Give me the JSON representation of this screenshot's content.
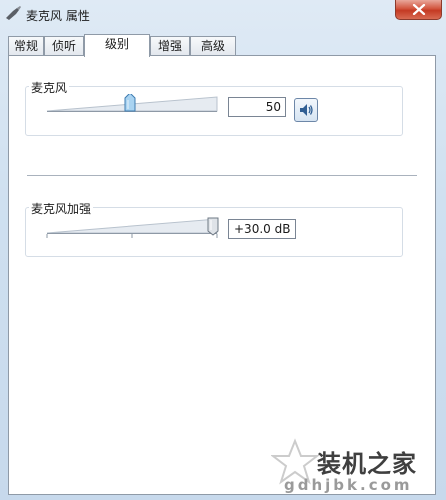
{
  "window": {
    "title": "麦克风 属性"
  },
  "tabs": [
    {
      "label": "常规",
      "active": false
    },
    {
      "label": "侦听",
      "active": false
    },
    {
      "label": "级别",
      "active": true
    },
    {
      "label": "增强",
      "active": false
    },
    {
      "label": "高级",
      "active": false
    }
  ],
  "microphone": {
    "label": "麦克风",
    "level_value": "50",
    "level_fraction": 0.5
  },
  "boost": {
    "label": "麦克风加强",
    "value_text": "+30.0 dB",
    "level_fraction": 1.0
  },
  "watermark": {
    "name": "装机之家",
    "url": "gdhjbk.com"
  },
  "colors": {
    "close_button": "#c43a23",
    "accent": "#3d87c4"
  }
}
